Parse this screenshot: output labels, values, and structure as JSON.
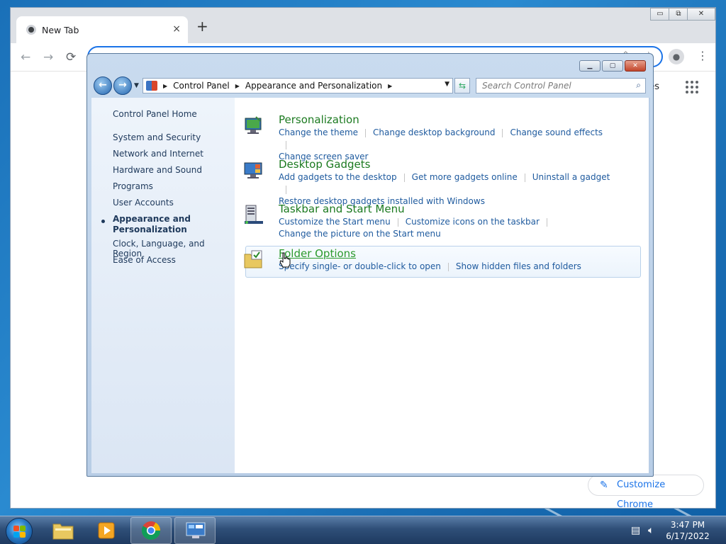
{
  "chrome": {
    "tab_title": "New Tab",
    "tab_close": "×",
    "new_tab": "+",
    "min": "▭",
    "restore": "⧉",
    "close": "✕",
    "back": "←",
    "forward": "→",
    "reload": "⟳",
    "images_text": "ges",
    "customize_label": "Customize Chrome"
  },
  "control_panel": {
    "breadcrumb": [
      "Control Panel",
      "Appearance and Personalization"
    ],
    "search_placeholder": "Search Control Panel",
    "left_nav": {
      "home": "Control Panel Home",
      "items": [
        "System and Security",
        "Network and Internet",
        "Hardware and Sound",
        "Programs",
        "User Accounts"
      ],
      "active_line1": "Appearance and",
      "active_line2": "Personalization",
      "items_after": [
        "Clock, Language, and Region",
        "Ease of Access"
      ]
    },
    "categories": [
      {
        "title": "Personalization",
        "links": [
          "Change the theme",
          "Change desktop background",
          "Change sound effects",
          "Change screen saver"
        ]
      },
      {
        "title": "Desktop Gadgets",
        "links": [
          "Add gadgets to the desktop",
          "Get more gadgets online",
          "Uninstall a gadget",
          "Restore desktop gadgets installed with Windows"
        ]
      },
      {
        "title": "Taskbar and Start Menu",
        "links": [
          "Customize the Start menu",
          "Customize icons on the taskbar",
          "Change the picture on the Start menu"
        ]
      },
      {
        "title": "Folder Options",
        "links": [
          "Specify single- or double-click to open",
          "Show hidden files and folders"
        ]
      }
    ]
  },
  "taskbar": {
    "time": "3:47 PM",
    "date": "6/17/2022"
  },
  "colors": {
    "category_title": "#1c7a20",
    "link": "#1e5a9e",
    "accent": "#1a73e8"
  }
}
